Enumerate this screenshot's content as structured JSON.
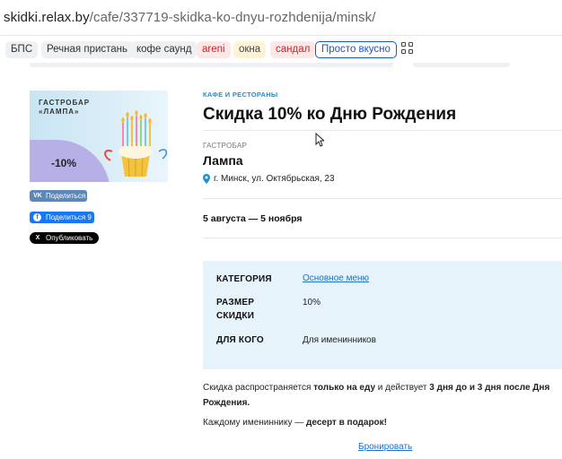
{
  "browser": {
    "url_host": "skidki.relax.by",
    "url_path": "/cafe/337719-skidka-ko-dnyu-rozhdenija/minsk/"
  },
  "bookmarks": [
    {
      "label": "БПС"
    },
    {
      "label": "Речная пристань"
    },
    {
      "label": "кофе саунд"
    },
    {
      "label": "areni"
    },
    {
      "label": "окна"
    },
    {
      "label": "сандал"
    },
    {
      "label": "Просто вкусно"
    }
  ],
  "promo_image": {
    "brand_line1": "ГАСТРОБАР",
    "brand_line2": "«ЛАМПА»",
    "discount": "-10%"
  },
  "share": {
    "vk": "Поделиться",
    "facebook": "Поделиться 9",
    "x": "Опубликовать"
  },
  "offer": {
    "category": "КАФЕ И РЕСТОРАНЫ",
    "title": "Скидка 10% ко Дню Рождения",
    "place_type": "ГАСТРОБАР",
    "place_name": "Лампа",
    "address": "г. Минск, ул. Октябрьская, 23",
    "dates": "5 августа — 5 ноября"
  },
  "details": {
    "category_label": "КАТЕГОРИЯ",
    "category_value": "Основное меню",
    "size_label_1": "РАЗМЕР",
    "size_label_2": "СКИДКИ",
    "size_value": "10%",
    "who_label": "ДЛЯ КОГО",
    "who_value": "Для именинников"
  },
  "description": {
    "p1_a": "Скидка распространяется ",
    "p1_b": "только на еду",
    "p1_c": " и действует ",
    "p1_d": "3 дня до и 3 дня после Дня Рождения.",
    "p2_a": "Каждому имениннику — ",
    "p2_b": "десерт в подарок!"
  },
  "book_link": "Бронировать",
  "colors": {
    "accent_blue": "#1d8fd4",
    "link_blue": "#1d6fc9",
    "info_bg": "#e6f3fb",
    "vk": "#4a76a8",
    "facebook": "#1877f2",
    "x": "#000000"
  }
}
